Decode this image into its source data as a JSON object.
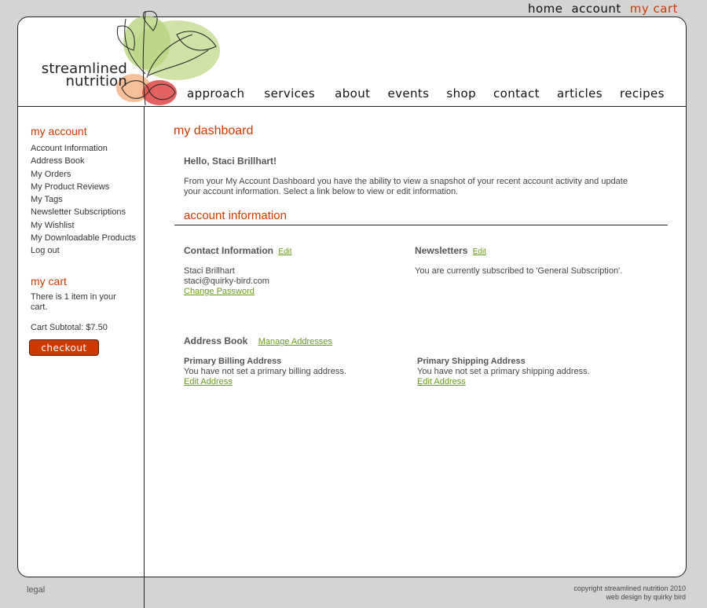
{
  "topnav": {
    "home": "home",
    "account": "account",
    "cart": "my cart"
  },
  "logo": {
    "line1": "streamlined",
    "line2": "nutrition"
  },
  "mainnav": [
    "approach",
    "services",
    "about",
    "events",
    "shop",
    "contact",
    "articles",
    "recipes"
  ],
  "sidebar": {
    "account_heading": "my account",
    "links": [
      "Account Information",
      "Address Book",
      "My Orders",
      "My Product Reviews",
      "My Tags",
      "Newsletter Subscriptions",
      "My Wishlist",
      "My Downloadable Products",
      "Log out"
    ],
    "cart_heading": "my cart",
    "cart_items_text": "There is 1 item in your cart.",
    "cart_subtotal": "Cart Subtotal: $7.50",
    "checkout_label": "checkout"
  },
  "main": {
    "title": "my dashboard",
    "greeting": "Hello, Staci Brillhart!",
    "intro": "From your My Account Dashboard you have the ability to view a snapshot of your recent account activity and update your account information. Select a link below to view or edit information.",
    "account_heading": "account information",
    "contact": {
      "title": "Contact Information",
      "edit": "Edit",
      "name": "Staci Brillhart",
      "email": "staci@quirky-bird.com",
      "change_password": "Change Password"
    },
    "newsletters": {
      "title": "Newsletters",
      "edit": "Edit",
      "status": "You are currently subscribed to 'General Subscription'."
    },
    "address_book": {
      "title": "Address Book",
      "manage": "Manage Addresses",
      "billing_title": "Primary Billing Address",
      "billing_text": "You have not set a primary billing address.",
      "billing_edit": "Edit Address",
      "shipping_title": "Primary Shipping Address",
      "shipping_text": "You have not set a primary shipping address.",
      "shipping_edit": "Edit Address"
    }
  },
  "footer": {
    "legal": "legal",
    "copyright": "copyright streamlined nutrition 2010",
    "credit": "web design by quirky bird"
  },
  "colors": {
    "accent": "#cc3a00",
    "link_green": "#6a9a1a",
    "background": "#d4d4d4"
  },
  "icons": {
    "header_art": "radish-illustration"
  }
}
